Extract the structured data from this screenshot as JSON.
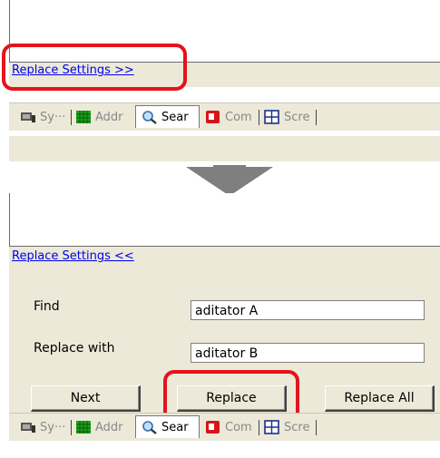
{
  "top": {
    "toggle_label": "Replace Settings >>"
  },
  "bottom": {
    "toggle_label": "Replace Settings <<",
    "find_label": "Find",
    "find_value": "aditator A",
    "replace_label": "Replace with",
    "replace_value": "aditator B",
    "buttons": {
      "next": "Next",
      "replace": "Replace",
      "replace_all": "Replace All"
    }
  },
  "tabs": [
    {
      "label": "Sy···",
      "icon": "system-icon"
    },
    {
      "label": "Addr",
      "icon": "address-grid-icon"
    },
    {
      "label": "Sear",
      "icon": "search-icon",
      "active": true
    },
    {
      "label": "Com",
      "icon": "comment-icon"
    },
    {
      "label": "Scre",
      "icon": "screen-icon"
    }
  ],
  "colors": {
    "highlight": "#e3141b",
    "panel": "#ece9d8",
    "link": "#0000ee",
    "arrow": "#7f7f7f"
  }
}
